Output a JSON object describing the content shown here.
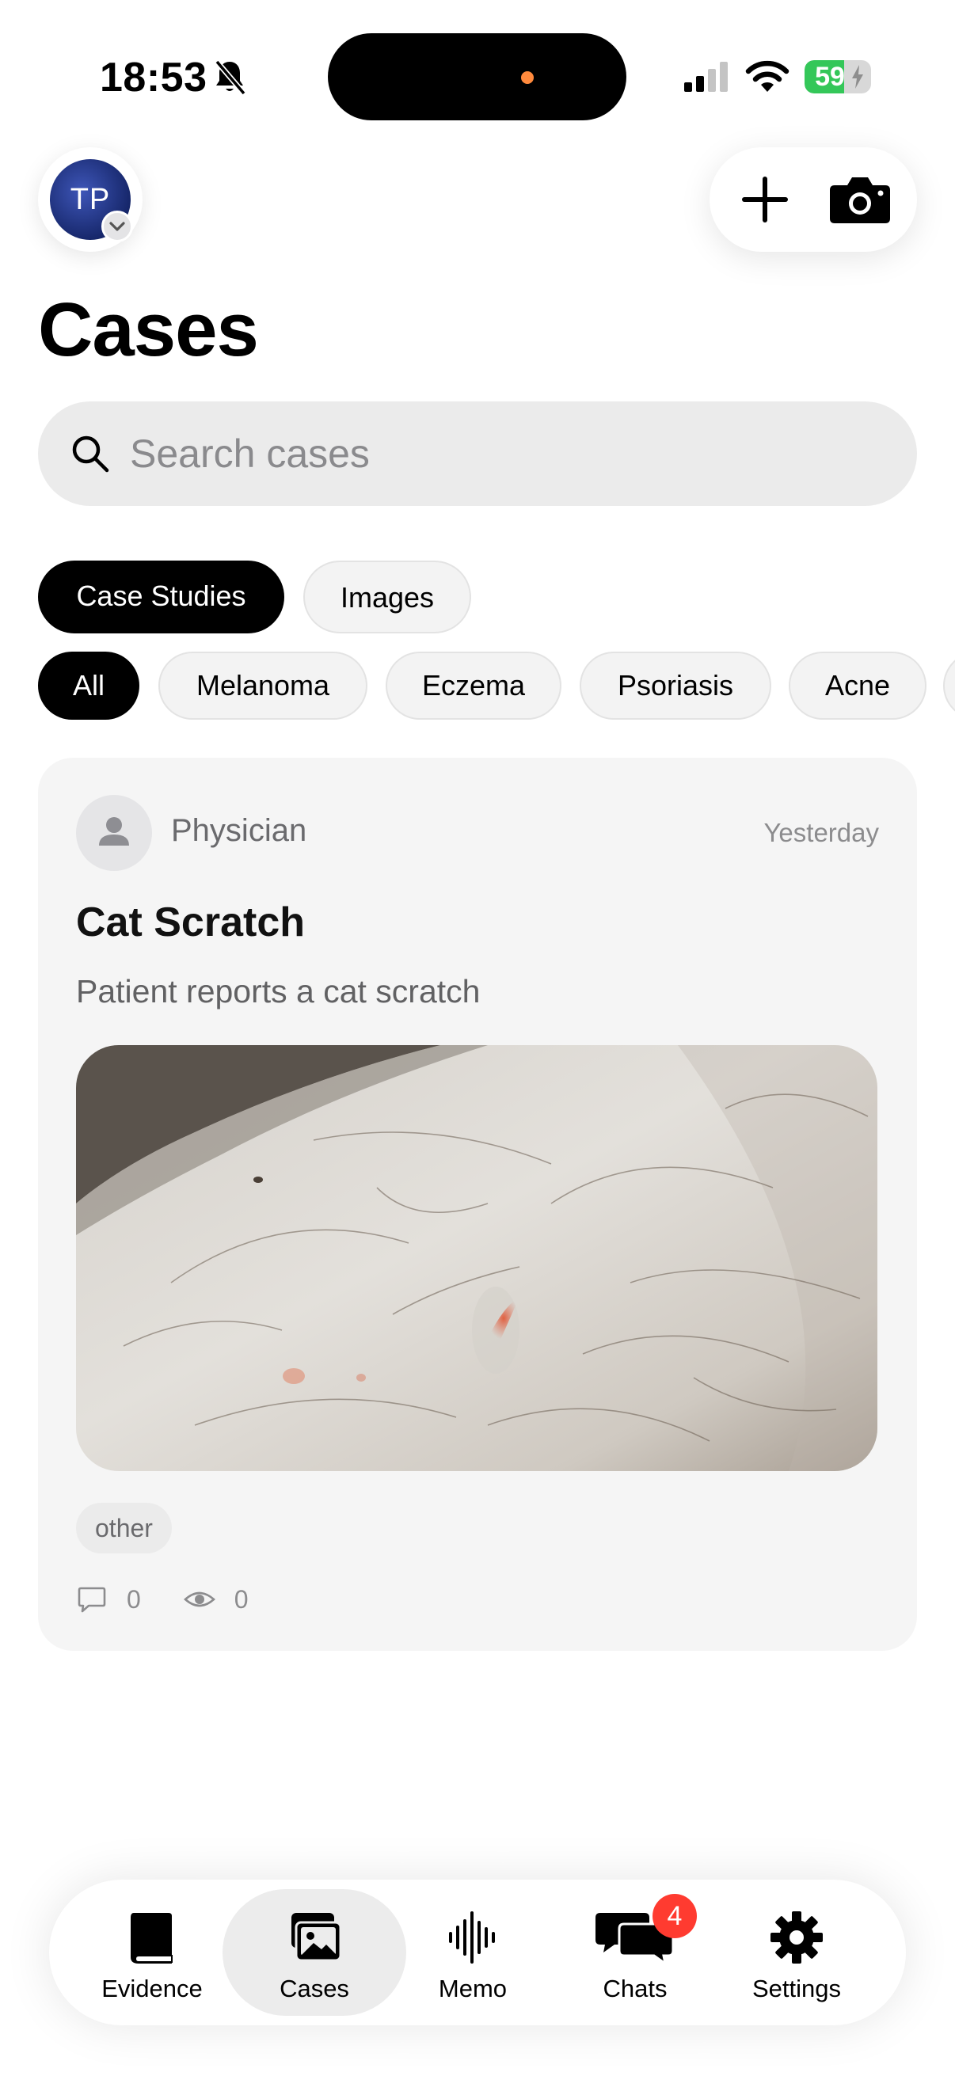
{
  "status_bar": {
    "time": "18:53",
    "battery": "59",
    "battery_level": 0.59,
    "colors": {
      "battery": "#34c759",
      "island_dot": "#ff8a3d"
    }
  },
  "header": {
    "avatar_initials": "TP",
    "title": "Cases",
    "icons": [
      "chevron-down-icon",
      "plus-icon",
      "camera-icon"
    ]
  },
  "search": {
    "placeholder": "Search cases",
    "value": ""
  },
  "segments": [
    {
      "label": "Case Studies",
      "active": true
    },
    {
      "label": "Images",
      "active": false
    }
  ],
  "filters": [
    {
      "label": "All",
      "active": true
    },
    {
      "label": "Melanoma",
      "active": false
    },
    {
      "label": "Eczema",
      "active": false
    },
    {
      "label": "Psoriasis",
      "active": false
    },
    {
      "label": "Acne",
      "active": false
    }
  ],
  "cases": [
    {
      "author": "Physician",
      "time": "Yesterday",
      "title": "Cat Scratch",
      "description": "Patient reports a cat scratch",
      "tag": "other",
      "comments": "0",
      "views": "0"
    }
  ],
  "tabbar": {
    "tabs": [
      {
        "label": "Evidence",
        "icon": "book-icon",
        "active": false
      },
      {
        "label": "Cases",
        "icon": "photos-icon",
        "active": true
      },
      {
        "label": "Memo",
        "icon": "waveform-icon",
        "active": false
      },
      {
        "label": "Chats",
        "icon": "chat-bubbles-icon",
        "active": false,
        "badge": "4"
      },
      {
        "label": "Settings",
        "icon": "gear-icon",
        "active": false
      }
    ],
    "colors": {
      "badge": "#ff3b30",
      "active_bg": "#ececec"
    }
  }
}
